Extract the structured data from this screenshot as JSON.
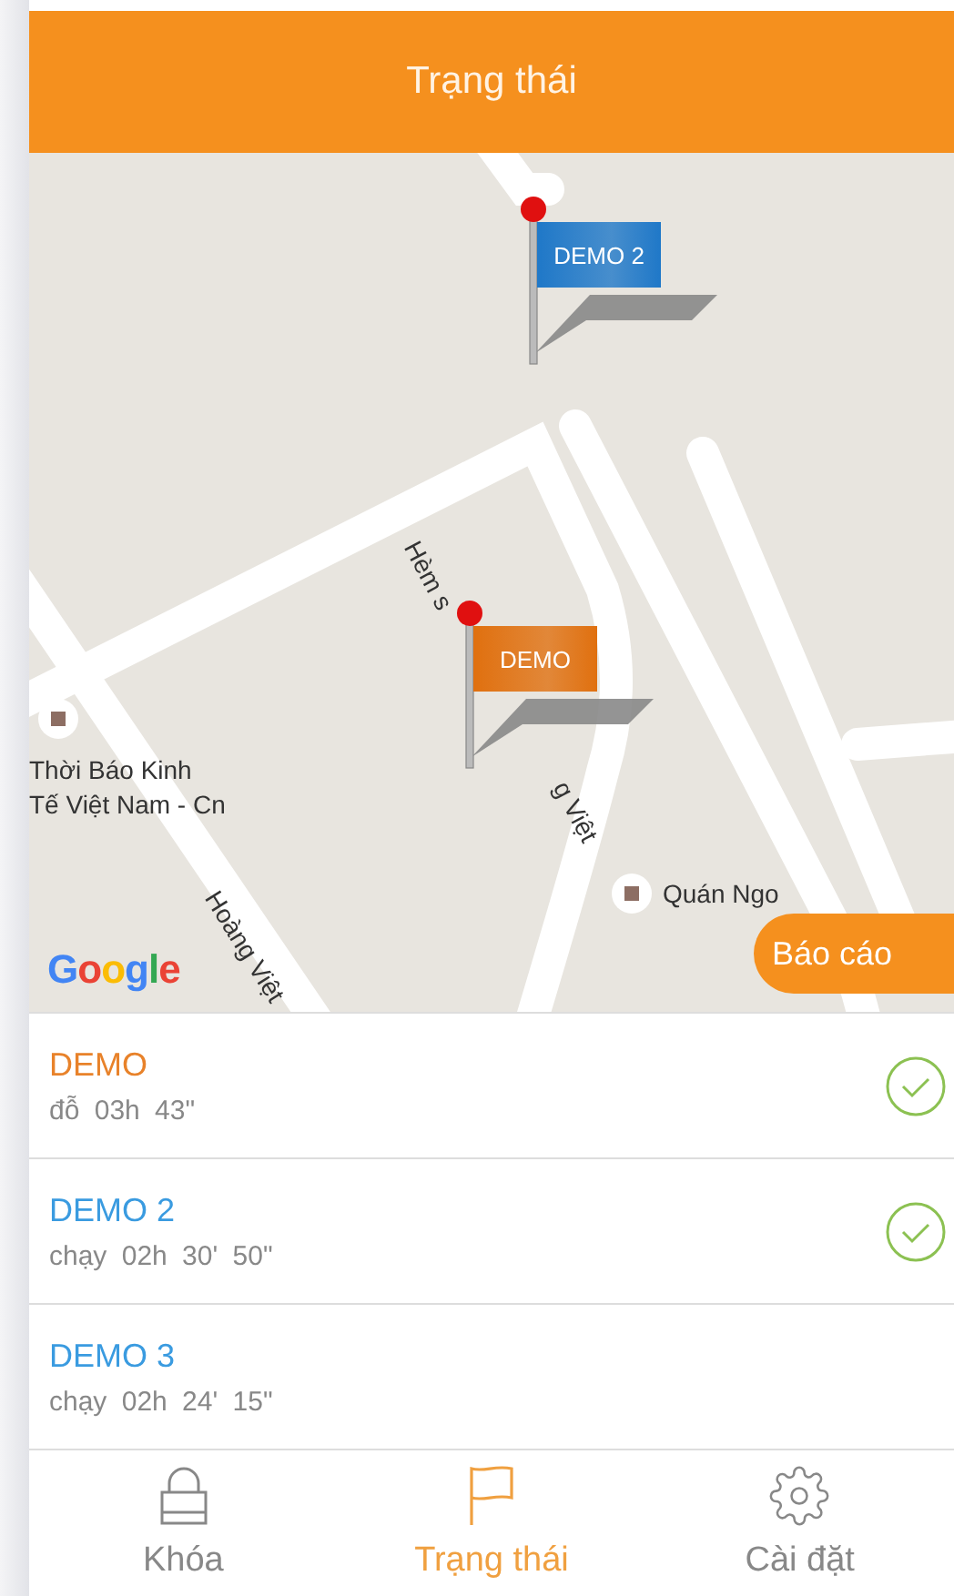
{
  "header": {
    "title": "Trạng thái"
  },
  "map": {
    "markers": [
      {
        "label": "DEMO 2",
        "color": "#1f78c8"
      },
      {
        "label": "DEMO",
        "color": "#e0700f"
      }
    ],
    "street_labels": [
      "Hèm s",
      "g Việt",
      "Hoàng Việt"
    ],
    "places": [
      "Thời Báo Kinh\nTế Việt Nam - Cn",
      "Quán Ngo"
    ],
    "logo": "Google",
    "report_button": "Báo cáo"
  },
  "vehicles": [
    {
      "name": "DEMO",
      "color": "#e8822a",
      "status": "đỗ",
      "duration": "03h 43\"",
      "checked": true
    },
    {
      "name": "DEMO 2",
      "color": "#3a9be0",
      "status": "chạy",
      "duration": "02h 30' 50\"",
      "checked": true
    },
    {
      "name": "DEMO 3",
      "color": "#3a9be0",
      "status": "chạy",
      "duration": "02h 24' 15\"",
      "checked": false
    }
  ],
  "tabs": [
    {
      "label": "Khóa",
      "kind": "lock",
      "selected": false
    },
    {
      "label": "Trạng thái",
      "kind": "flag",
      "selected": true
    },
    {
      "label": "Cài đặt",
      "kind": "gear",
      "selected": false
    }
  ]
}
